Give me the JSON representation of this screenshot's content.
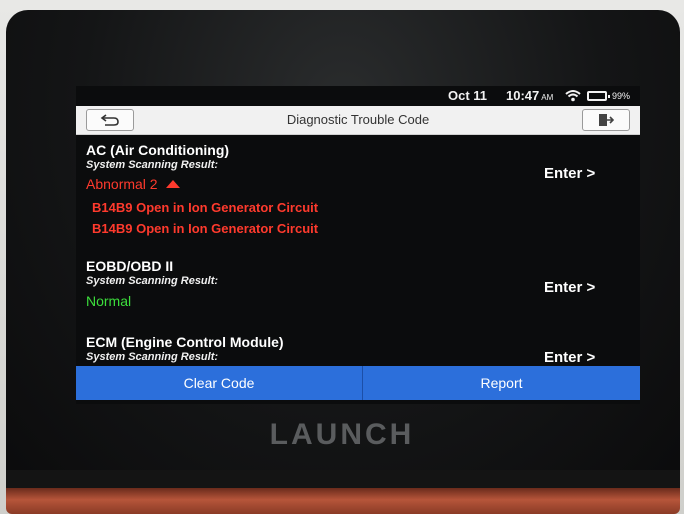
{
  "status_bar": {
    "date": "Oct 11",
    "time": "10:47",
    "ampm": "AM",
    "battery": "99%",
    "wifi_icon": "wifi-icon",
    "battery_icon": "battery-icon"
  },
  "header": {
    "title": "Diagnostic Trouble Code",
    "back_icon": "back-arrow-icon",
    "exit_icon": "exit-icon"
  },
  "systems": [
    {
      "name": "AC (Air Conditioning)",
      "result_label": "System Scanning Result:",
      "status": "Abnormal 2",
      "codes": [
        "B14B9 Open in Ion Generator Circuit",
        "B14B9 Open in Ion Generator Circuit"
      ],
      "enter_label": "Enter >"
    },
    {
      "name": "EOBD/OBD II",
      "result_label": "System Scanning Result:",
      "status": "Normal",
      "enter_label": "Enter >"
    },
    {
      "name": "ECM (Engine Control Module)",
      "result_label": "System Scanning Result:",
      "enter_label": "Enter >"
    }
  ],
  "buttons": {
    "clear_code": "Clear Code",
    "report": "Report"
  },
  "brand": "LAUNCH",
  "colors": {
    "abnormal": "#ff3a2d",
    "normal": "#3cde3c",
    "button_blue": "#2c6fdb"
  }
}
